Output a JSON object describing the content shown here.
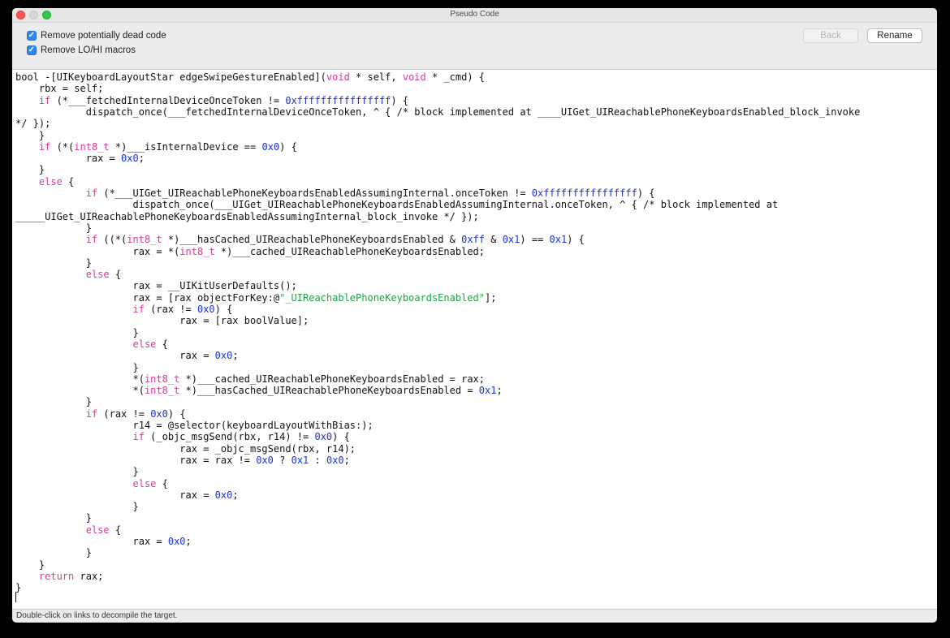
{
  "window": {
    "title": "Pseudo Code"
  },
  "options": [
    {
      "label": "Remove potentially dead code",
      "checked": true
    },
    {
      "label": "Remove LO/HI macros",
      "checked": true
    }
  ],
  "buttons": {
    "back": "Back",
    "rename": "Rename"
  },
  "code": {
    "lines": [
      [
        {
          "t": "bool -[UIKeyboardLayoutStar edgeSwipeGestureEnabled]("
        },
        {
          "t": "void",
          "c": "kw"
        },
        {
          "t": " * self, "
        },
        {
          "t": "void",
          "c": "kw"
        },
        {
          "t": " * _cmd) {"
        }
      ],
      [
        {
          "t": "    rbx = self;"
        }
      ],
      [
        {
          "t": "    "
        },
        {
          "t": "if",
          "c": "kw"
        },
        {
          "t": " (*___fetchedInternalDeviceOnceToken != "
        },
        {
          "t": "0xffffffffffffffff",
          "c": "num"
        },
        {
          "t": ") {"
        }
      ],
      [
        {
          "t": "            dispatch_once(___fetchedInternalDeviceOnceToken, ^ { /* block implemented at ____UIGet_UIReachablePhoneKeyboardsEnabled_block_invoke"
        }
      ],
      [
        {
          "t": "*/ });"
        }
      ],
      [
        {
          "t": "    }"
        }
      ],
      [
        {
          "t": "    "
        },
        {
          "t": "if",
          "c": "kw"
        },
        {
          "t": " (*("
        },
        {
          "t": "int8_t",
          "c": "kw"
        },
        {
          "t": " *)___isInternalDevice == "
        },
        {
          "t": "0x0",
          "c": "num"
        },
        {
          "t": ") {"
        }
      ],
      [
        {
          "t": "            rax = "
        },
        {
          "t": "0x0",
          "c": "num"
        },
        {
          "t": ";"
        }
      ],
      [
        {
          "t": "    }"
        }
      ],
      [
        {
          "t": "    "
        },
        {
          "t": "else",
          "c": "kw"
        },
        {
          "t": " {"
        }
      ],
      [
        {
          "t": "            "
        },
        {
          "t": "if",
          "c": "kw"
        },
        {
          "t": " (*___UIGet_UIReachablePhoneKeyboardsEnabledAssumingInternal.onceToken != "
        },
        {
          "t": "0xffffffffffffffff",
          "c": "num"
        },
        {
          "t": ") {"
        }
      ],
      [
        {
          "t": "                    dispatch_once(___UIGet_UIReachablePhoneKeyboardsEnabledAssumingInternal.onceToken, ^ { /* block implemented at"
        }
      ],
      [
        {
          "t": "_____UIGet_UIReachablePhoneKeyboardsEnabledAssumingInternal_block_invoke */ });"
        }
      ],
      [
        {
          "t": "            }"
        }
      ],
      [
        {
          "t": "            "
        },
        {
          "t": "if",
          "c": "kw"
        },
        {
          "t": " ((*("
        },
        {
          "t": "int8_t",
          "c": "kw"
        },
        {
          "t": " *)___hasCached_UIReachablePhoneKeyboardsEnabled & "
        },
        {
          "t": "0xff",
          "c": "num"
        },
        {
          "t": " & "
        },
        {
          "t": "0x1",
          "c": "num"
        },
        {
          "t": ") == "
        },
        {
          "t": "0x1",
          "c": "num"
        },
        {
          "t": ") {"
        }
      ],
      [
        {
          "t": "                    rax = *("
        },
        {
          "t": "int8_t",
          "c": "kw"
        },
        {
          "t": " *)___cached_UIReachablePhoneKeyboardsEnabled;"
        }
      ],
      [
        {
          "t": "            }"
        }
      ],
      [
        {
          "t": "            "
        },
        {
          "t": "else",
          "c": "kw"
        },
        {
          "t": " {"
        }
      ],
      [
        {
          "t": "                    rax = __UIKitUserDefaults();"
        }
      ],
      [
        {
          "t": "                    rax = [rax objectForKey:@"
        },
        {
          "t": "\"_UIReachablePhoneKeyboardsEnabled\"",
          "c": "str"
        },
        {
          "t": "];"
        }
      ],
      [
        {
          "t": "                    "
        },
        {
          "t": "if",
          "c": "kw"
        },
        {
          "t": " (rax != "
        },
        {
          "t": "0x0",
          "c": "num"
        },
        {
          "t": ") {"
        }
      ],
      [
        {
          "t": "                            rax = [rax boolValue];"
        }
      ],
      [
        {
          "t": "                    }"
        }
      ],
      [
        {
          "t": "                    "
        },
        {
          "t": "else",
          "c": "kw"
        },
        {
          "t": " {"
        }
      ],
      [
        {
          "t": "                            rax = "
        },
        {
          "t": "0x0",
          "c": "num"
        },
        {
          "t": ";"
        }
      ],
      [
        {
          "t": "                    }"
        }
      ],
      [
        {
          "t": "                    *("
        },
        {
          "t": "int8_t",
          "c": "kw"
        },
        {
          "t": " *)___cached_UIReachablePhoneKeyboardsEnabled = rax;"
        }
      ],
      [
        {
          "t": "                    *("
        },
        {
          "t": "int8_t",
          "c": "kw"
        },
        {
          "t": " *)___hasCached_UIReachablePhoneKeyboardsEnabled = "
        },
        {
          "t": "0x1",
          "c": "num"
        },
        {
          "t": ";"
        }
      ],
      [
        {
          "t": "            }"
        }
      ],
      [
        {
          "t": "            "
        },
        {
          "t": "if",
          "c": "kw"
        },
        {
          "t": " (rax != "
        },
        {
          "t": "0x0",
          "c": "num"
        },
        {
          "t": ") {"
        }
      ],
      [
        {
          "t": "                    r14 = @selector(keyboardLayoutWithBias:);"
        }
      ],
      [
        {
          "t": "                    "
        },
        {
          "t": "if",
          "c": "kw"
        },
        {
          "t": " (_objc_msgSend(rbx, r14) != "
        },
        {
          "t": "0x0",
          "c": "num"
        },
        {
          "t": ") {"
        }
      ],
      [
        {
          "t": "                            rax = _objc_msgSend(rbx, r14);"
        }
      ],
      [
        {
          "t": "                            rax = rax != "
        },
        {
          "t": "0x0",
          "c": "num"
        },
        {
          "t": " ? "
        },
        {
          "t": "0x1",
          "c": "num"
        },
        {
          "t": " : "
        },
        {
          "t": "0x0",
          "c": "num"
        },
        {
          "t": ";"
        }
      ],
      [
        {
          "t": "                    }"
        }
      ],
      [
        {
          "t": "                    "
        },
        {
          "t": "else",
          "c": "kw"
        },
        {
          "t": " {"
        }
      ],
      [
        {
          "t": "                            rax = "
        },
        {
          "t": "0x0",
          "c": "num"
        },
        {
          "t": ";"
        }
      ],
      [
        {
          "t": "                    }"
        }
      ],
      [
        {
          "t": "            }"
        }
      ],
      [
        {
          "t": "            "
        },
        {
          "t": "else",
          "c": "kw"
        },
        {
          "t": " {"
        }
      ],
      [
        {
          "t": "                    rax = "
        },
        {
          "t": "0x0",
          "c": "num"
        },
        {
          "t": ";"
        }
      ],
      [
        {
          "t": "            }"
        }
      ],
      [
        {
          "t": "    }"
        }
      ],
      [
        {
          "t": "    "
        },
        {
          "t": "return",
          "c": "kw"
        },
        {
          "t": " rax;"
        }
      ],
      [
        {
          "t": "}"
        }
      ]
    ]
  },
  "status": "Double-click on links to decompile the target."
}
